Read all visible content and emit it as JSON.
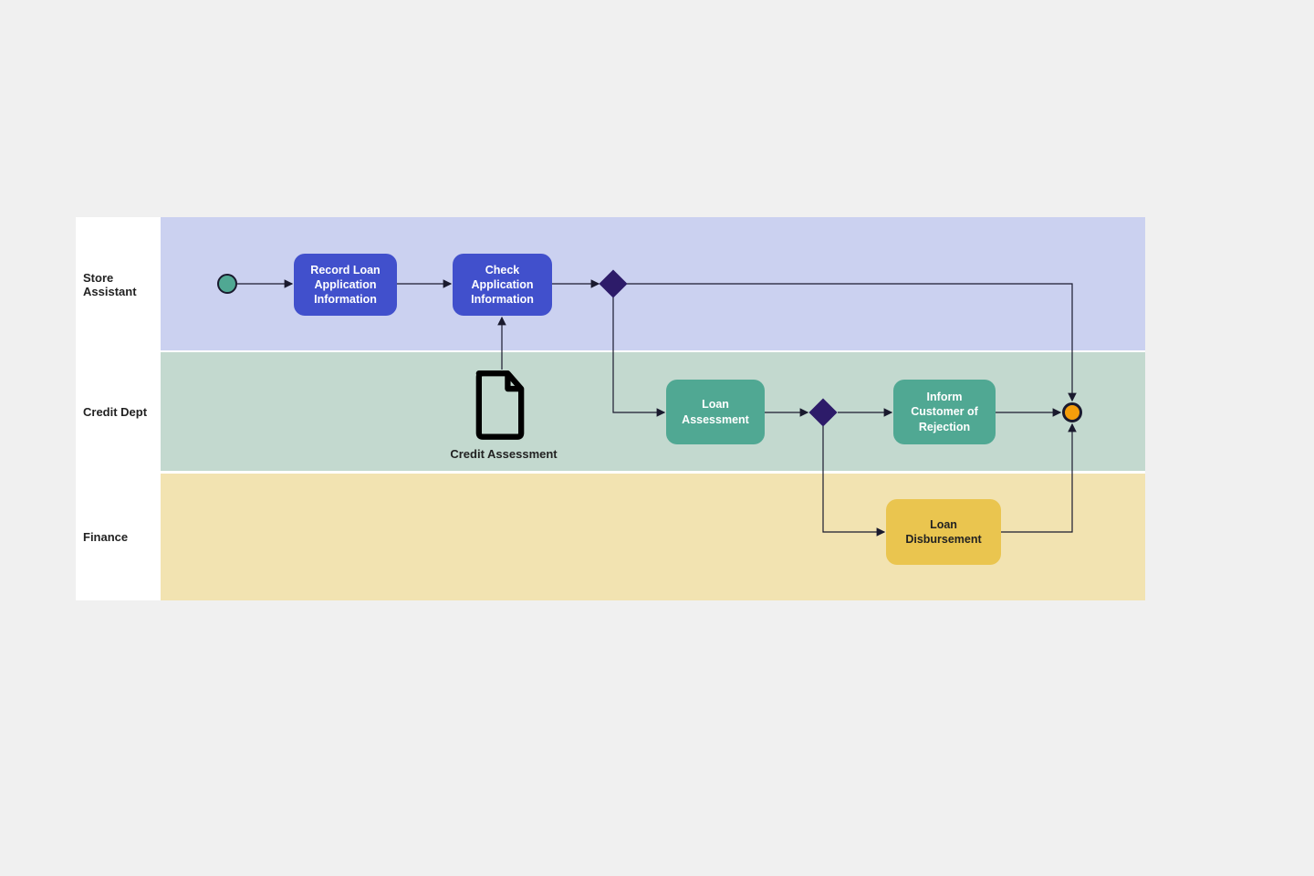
{
  "lanes": {
    "l1": "Store Assistant",
    "l2": "Credit Dept",
    "l3": "Finance"
  },
  "nodes": {
    "start": {
      "type": "start-event"
    },
    "record": "Record Loan Application Information",
    "check": "Check Application Information",
    "gateway1": {
      "type": "exclusive-gateway"
    },
    "doc": "Credit Assessment",
    "assess": "Loan Assessment",
    "gateway2": {
      "type": "exclusive-gateway"
    },
    "reject": "Inform Customer of Rejection",
    "disburse": "Loan Disbursement",
    "end": {
      "type": "end-event"
    }
  },
  "flows": [
    {
      "from": "start",
      "to": "record"
    },
    {
      "from": "record",
      "to": "check"
    },
    {
      "from": "doc",
      "to": "check",
      "type": "data-association"
    },
    {
      "from": "check",
      "to": "gateway1"
    },
    {
      "from": "gateway1",
      "to": "end",
      "path": "top"
    },
    {
      "from": "gateway1",
      "to": "assess"
    },
    {
      "from": "assess",
      "to": "gateway2"
    },
    {
      "from": "gateway2",
      "to": "reject"
    },
    {
      "from": "gateway2",
      "to": "disburse"
    },
    {
      "from": "reject",
      "to": "end"
    },
    {
      "from": "disburse",
      "to": "end"
    }
  ]
}
